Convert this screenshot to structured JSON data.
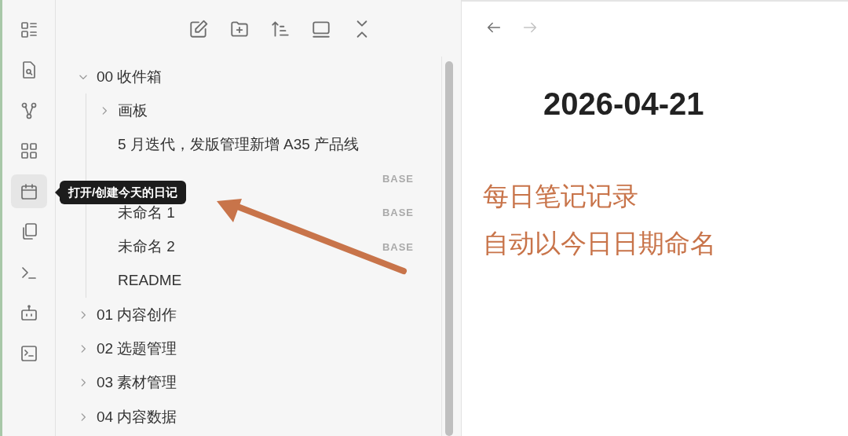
{
  "ribbon": [
    {
      "kind": "layout",
      "selected": false
    },
    {
      "kind": "search-doc",
      "selected": false
    },
    {
      "kind": "graph",
      "selected": false
    },
    {
      "kind": "grid",
      "selected": false
    },
    {
      "kind": "calendar",
      "selected": true
    },
    {
      "kind": "copy",
      "selected": false
    },
    {
      "kind": "prompt",
      "selected": false
    },
    {
      "kind": "bot",
      "selected": false
    },
    {
      "kind": "terminal",
      "selected": false
    }
  ],
  "tooltip": "打开/创建今天的日记",
  "toolbar": [
    {
      "kind": "edit"
    },
    {
      "kind": "new-folder"
    },
    {
      "kind": "sort"
    },
    {
      "kind": "window"
    },
    {
      "kind": "collapse"
    }
  ],
  "tree": [
    {
      "kind": "folder",
      "label": "00 收件箱",
      "expanded": true,
      "children": [
        {
          "kind": "folder",
          "label": "画板",
          "expanded": false
        },
        {
          "kind": "file",
          "label": "5 月迭代，发版管理新增 A35 产品线"
        },
        {
          "kind": "file",
          "tag": "BASE"
        },
        {
          "kind": "file",
          "label": "未命名 1",
          "tag": "BASE"
        },
        {
          "kind": "file",
          "label": "未命名 2",
          "tag": "BASE"
        },
        {
          "kind": "file",
          "label": "README"
        }
      ]
    },
    {
      "kind": "folder",
      "label": "01 内容创作",
      "expanded": false
    },
    {
      "kind": "folder",
      "label": "02 选题管理",
      "expanded": false
    },
    {
      "kind": "folder",
      "label": "03 素材管理",
      "expanded": false
    },
    {
      "kind": "folder",
      "label": "04 内容数据",
      "expanded": false
    }
  ],
  "nav": [
    {
      "kind": "back",
      "disabled": false
    },
    {
      "kind": "forward",
      "disabled": true
    }
  ],
  "note": {
    "title": "2026-04-21",
    "lines": [
      "每日笔记记录",
      "自动以今日日期命名"
    ]
  }
}
